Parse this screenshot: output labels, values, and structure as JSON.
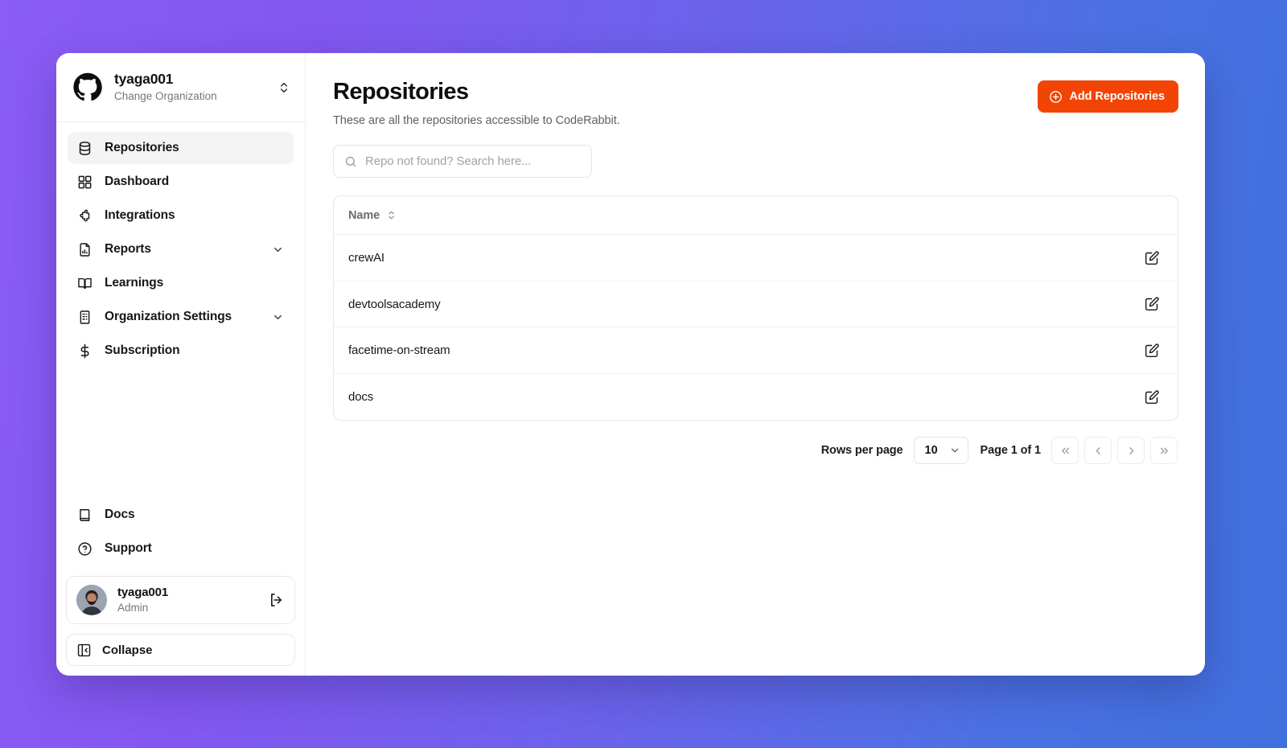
{
  "org": {
    "logo_icon": "github-icon",
    "name": "tyaga001",
    "subtitle": "Change Organization",
    "switch_icon": "chevrons-up-down-icon"
  },
  "sidebar": {
    "items": [
      {
        "label": "Repositories",
        "icon": "database-icon",
        "active": true,
        "expandable": false
      },
      {
        "label": "Dashboard",
        "icon": "grid-icon",
        "active": false,
        "expandable": false
      },
      {
        "label": "Integrations",
        "icon": "puzzle-icon",
        "active": false,
        "expandable": false
      },
      {
        "label": "Reports",
        "icon": "file-chart-icon",
        "active": false,
        "expandable": true
      },
      {
        "label": "Learnings",
        "icon": "book-open-icon",
        "active": false,
        "expandable": false
      },
      {
        "label": "Organization Settings",
        "icon": "building-icon",
        "active": false,
        "expandable": true
      },
      {
        "label": "Subscription",
        "icon": "dollar-icon",
        "active": false,
        "expandable": false
      }
    ],
    "bottom_items": [
      {
        "label": "Docs",
        "icon": "book-icon"
      },
      {
        "label": "Support",
        "icon": "help-circle-icon"
      }
    ],
    "user": {
      "name": "tyaga001",
      "role": "Admin",
      "avatar_icon": "user-avatar",
      "logout_icon": "log-out-icon"
    },
    "collapse": {
      "label": "Collapse",
      "icon": "panel-left-close-icon"
    }
  },
  "main": {
    "title": "Repositories",
    "subtitle": "These are all the repositories accessible to CodeRabbit.",
    "add_button": {
      "label": "Add Repositories",
      "icon": "plus-circle-icon",
      "color": "#f24405"
    },
    "search": {
      "placeholder": "Repo not found? Search here...",
      "value": "",
      "icon": "search-icon"
    },
    "table": {
      "columns": [
        {
          "label": "Name",
          "sort_icon": "chevrons-up-down-icon"
        }
      ],
      "row_action_icon": "square-pen-icon",
      "rows": [
        {
          "name": "crewAI"
        },
        {
          "name": "devtoolsacademy"
        },
        {
          "name": "facetime-on-stream"
        },
        {
          "name": "docs"
        }
      ]
    },
    "pagination": {
      "rows_per_page_label": "Rows per page",
      "rows_per_page_value": "10",
      "rows_per_page_icon": "chevron-down-icon",
      "page_status": "Page 1 of 1",
      "buttons": [
        {
          "name": "first-page",
          "glyph": "chevrons-left-icon"
        },
        {
          "name": "previous-page",
          "glyph": "chevron-left-icon"
        },
        {
          "name": "next-page",
          "glyph": "chevron-right-icon"
        },
        {
          "name": "last-page",
          "glyph": "chevrons-right-icon"
        }
      ]
    }
  }
}
